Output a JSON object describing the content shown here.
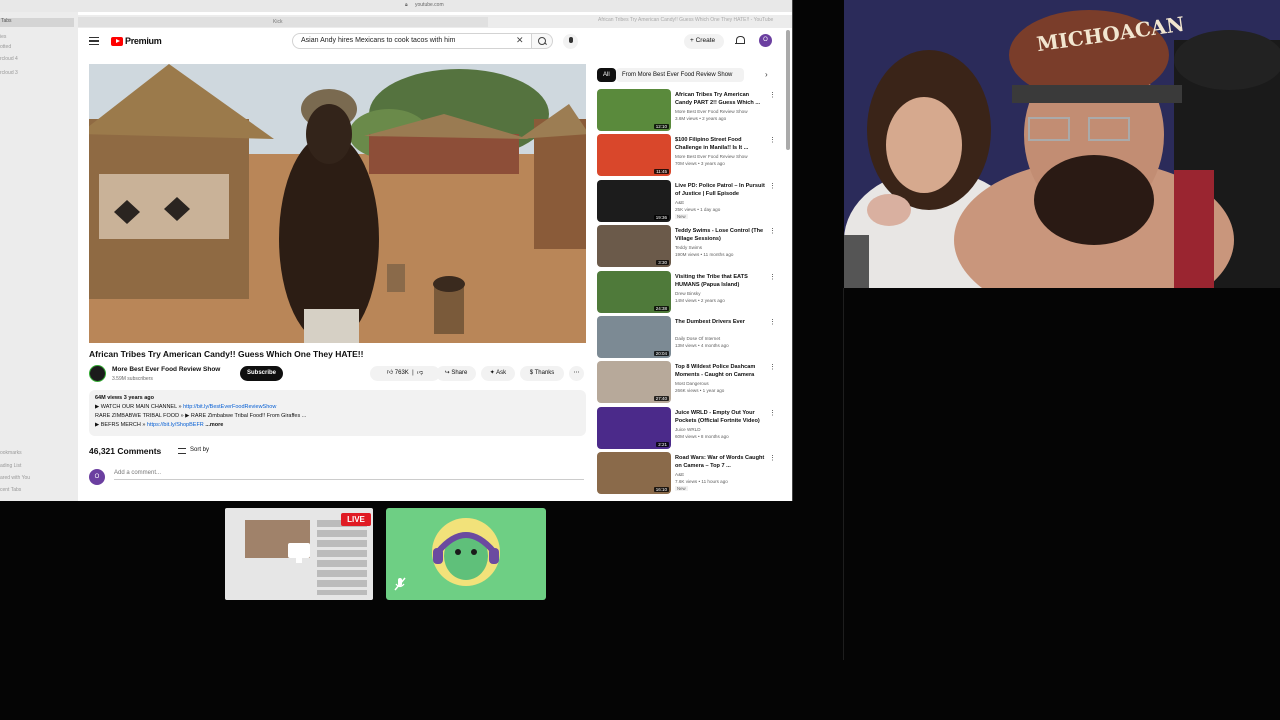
{
  "browser": {
    "url": "youtube.com",
    "tab_title": "Kick",
    "tab2_title": "African Tribes Try American Candy!! Guess Which One They HATE!! - YouTube",
    "sidebar_items": [
      "Tabs",
      "ies",
      "otted",
      "rcloud 4",
      "rcloud 3"
    ],
    "sidebar_bottom": [
      "ookmarks",
      "ading List",
      "ared with You",
      "cent Tabs"
    ]
  },
  "header": {
    "logo": "Premium",
    "search_value": "Asian Andy hires Mexicans to cook tacos with him",
    "create_label": "Create",
    "avatar_letter": "O"
  },
  "video": {
    "title": "African Tribes Try American Candy!! Guess Which One They HATE!!",
    "channel": "More Best Ever Food Review Show",
    "subscribers": "3.59M subscribers",
    "subscribe_label": "Subscribe",
    "likes": "763K",
    "share_label": "Share",
    "ask_label": "Ask",
    "thanks_label": "Thanks"
  },
  "description": {
    "stats": "64M views  3 years ago",
    "line1_text": "WATCH OUR MAIN CHANNEL »",
    "line1_link": "http://bit.ly/BestEverFoodReviewShow",
    "line2": "RARE ZIMBABWE TRIBAL FOOD » ▶ RARE Zimbabwe Tribal Food!! From Giraffes ...",
    "line3_text": "BEFRS MERCH »",
    "line3_link": "https://bit.ly/ShopBEFR",
    "more": "...more"
  },
  "comments": {
    "count": "46,321 Comments",
    "sort": "Sort by",
    "placeholder": "Add a comment...",
    "avatar_letter": "O"
  },
  "chips": {
    "all": "All",
    "from": "From More Best Ever Food Review Show",
    "next": "›"
  },
  "recommendations": [
    {
      "title": "African Tribes Try American Candy PART 2!! Guess Which ...",
      "channel": "More Best Ever Food Review Show",
      "meta": "3.6M views • 2 years ago",
      "duration": "12:10",
      "badge": "",
      "color": "#5a8a3c"
    },
    {
      "title": "$100 Filipino Street Food Challenge in Manila!! Is It ...",
      "channel": "More Best Ever Food Review Show",
      "meta": "70M views • 3 years ago",
      "duration": "11:45",
      "badge": "",
      "color": "#d9472b"
    },
    {
      "title": "Live PD: Police Patrol – In Pursuit of Justice | Full Episode",
      "channel": "A&E",
      "meta": "25K views • 1 day ago",
      "duration": "19:36",
      "badge": "New",
      "color": "#1c1c1c"
    },
    {
      "title": "Teddy Swims - Lose Control (The Village Sessions)",
      "channel": "Teddy Swims",
      "meta": "190M views • 11 months ago",
      "duration": "3:30",
      "badge": "",
      "color": "#6b5a4a"
    },
    {
      "title": "Visiting the Tribe that EATS HUMANS (Papua Island)",
      "channel": "Drew Binsky",
      "meta": "14M views • 2 years ago",
      "duration": "24:38",
      "badge": "",
      "color": "#4f7a3a"
    },
    {
      "title": "The Dumbest Drivers Ever",
      "channel": "Daily Dose Of Internet",
      "meta": "13M views • 4 months ago",
      "duration": "20:04",
      "badge": "",
      "color": "#7c8a94"
    },
    {
      "title": "Top 8 Wildest Police Dashcam Moments - Caught on Camera",
      "channel": "Most Dangerous",
      "meta": "266K views • 1 year ago",
      "duration": "27:40",
      "badge": "",
      "color": "#b7a99a"
    },
    {
      "title": "Juice WRLD - Empty Out Your Pockets (Official Fortnite Video)",
      "channel": "Juice WRLD",
      "meta": "60M views • 8 months ago",
      "duration": "2:21",
      "badge": "",
      "color": "#4b2a8a"
    },
    {
      "title": "Road Wars: War of Words Caught on Camera – Top 7 ...",
      "channel": "A&E",
      "meta": "7.6K views • 11 hours ago",
      "duration": "16:10",
      "badge": "New",
      "color": "#8a6a4a"
    }
  ],
  "call": {
    "live_label": "LIVE"
  },
  "colors": {
    "accent_red": "#ff0000",
    "live_red": "#e01b24",
    "tile_green": "#6ecf84",
    "link_blue": "#065fd4"
  },
  "webcam": {
    "hat_text": "MICHOACAN"
  }
}
